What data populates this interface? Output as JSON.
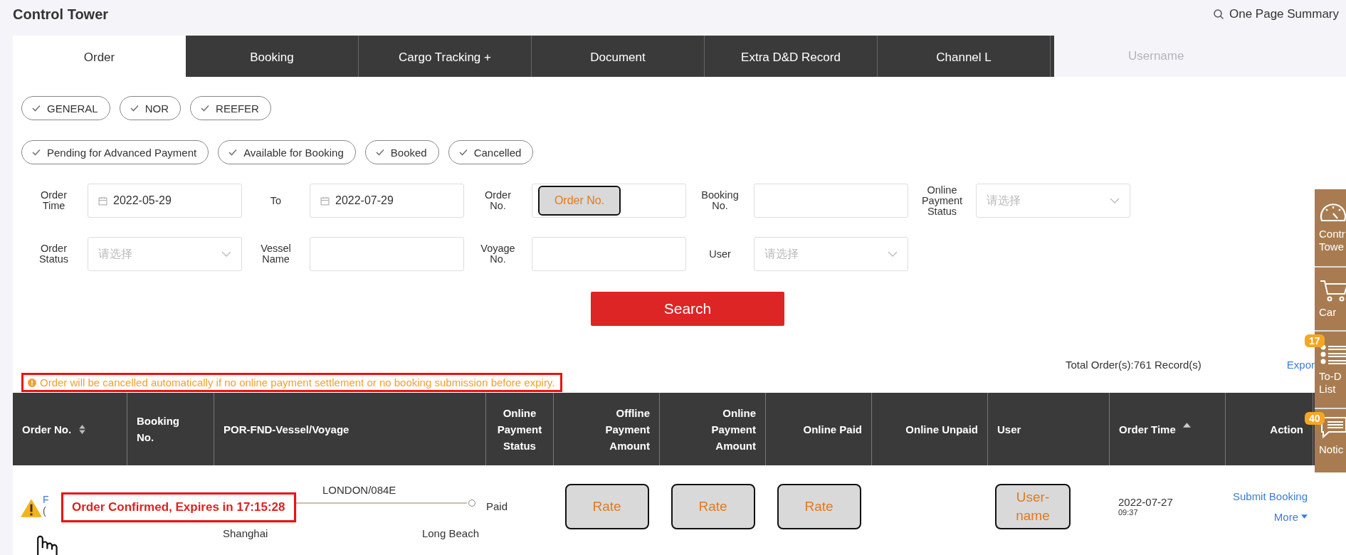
{
  "page": {
    "title": "Control Tower",
    "summary_link": "One Page Summary"
  },
  "tabs": [
    {
      "label": "Order",
      "selected": true
    },
    {
      "label": "Booking",
      "selected": false
    },
    {
      "label": "Cargo Tracking +",
      "selected": false
    },
    {
      "label": "Document",
      "selected": false
    },
    {
      "label": "Extra D&D Record",
      "selected": false
    },
    {
      "label": "Channel L",
      "selected": false
    }
  ],
  "faint_username": "Username",
  "cargo_filters": [
    {
      "label": "GENERAL",
      "checked": true
    },
    {
      "label": "NOR",
      "checked": true
    },
    {
      "label": "REEFER",
      "checked": true
    }
  ],
  "status_filters": [
    {
      "label": "Pending for Advanced Payment",
      "checked": true
    },
    {
      "label": "Available for Booking",
      "checked": true
    },
    {
      "label": "Booked",
      "checked": true
    },
    {
      "label": "Cancelled",
      "checked": true
    }
  ],
  "fields": [
    {
      "label": "Order Time",
      "kind": "date",
      "value": "2022-05-29"
    },
    {
      "label": "To",
      "kind": "date",
      "value": "2022-07-29"
    },
    {
      "label": "Order No.",
      "kind": "text",
      "overlay": "Order No."
    },
    {
      "label": "Booking No.",
      "kind": "text"
    },
    {
      "label": "Online Payment Status",
      "kind": "select",
      "placeholder": "请选择"
    },
    {
      "label": "Order Status",
      "kind": "select",
      "placeholder": "请选择"
    },
    {
      "label": "Vessel Name",
      "kind": "text"
    },
    {
      "label": "Voyage No.",
      "kind": "text"
    },
    {
      "label": "User",
      "kind": "select",
      "placeholder": "请选择"
    }
  ],
  "search_button": "Search",
  "total": "Total Order(s):761 Record(s)",
  "export_link": "Expor",
  "notice": "Order will be cancelled automatically if no online payment settlement or no booking submission before expiry.",
  "table": {
    "columns": [
      {
        "label": "Order No.",
        "kind": "sortable"
      },
      {
        "label": "Booking No.",
        "kind": "plain"
      },
      {
        "label": "POR-FND-Vessel/Voyage",
        "kind": "plain"
      },
      {
        "label": "Online Payment Status",
        "kind": "plain"
      },
      {
        "label": "Offline Payment Amount",
        "kind": "plain"
      },
      {
        "label": "Online Payment Amount",
        "kind": "plain"
      },
      {
        "label": "Online Paid",
        "kind": "plain"
      },
      {
        "label": "Online Unpaid",
        "kind": "plain"
      },
      {
        "label": "User",
        "kind": "plain"
      },
      {
        "label": "Order Time",
        "kind": "sorted"
      },
      {
        "label": "Action",
        "kind": "plain"
      }
    ],
    "rows": [
      {
        "order_no": "F",
        "order_sub": "(",
        "vessel": "LONDON/084E",
        "por": "Shanghai",
        "fnd": "Long Beach",
        "payment_status": "Paid",
        "offline": "Rate",
        "online_amount": "Rate",
        "online_paid": "Rate",
        "user": "User-name",
        "date": "2022-07-27",
        "time": "09:37",
        "actions": [
          "Submit Booking",
          "More"
        ]
      }
    ]
  },
  "tooltip": "Order Confirmed, Expires in 17:15:28",
  "sidebar": [
    {
      "label": "Contr Towe",
      "kind": "gauge"
    },
    {
      "label": "Car",
      "kind": "cart"
    },
    {
      "label": "To-D List",
      "kind": "list",
      "badge": "17"
    },
    {
      "label": "Notic",
      "kind": "chat",
      "badge": "40"
    }
  ]
}
